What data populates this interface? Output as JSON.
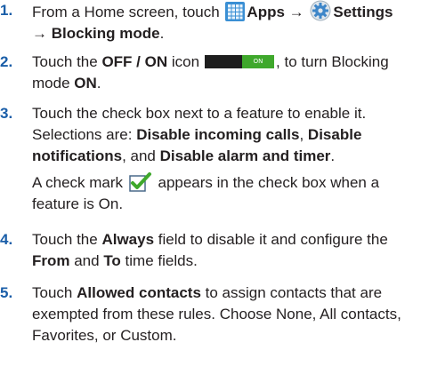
{
  "steps": [
    {
      "number": "1.",
      "t1": "From a Home screen, touch ",
      "apps_label": "Apps",
      "arrow1": " → ",
      "settings_label": "Settings",
      "line2_arrow": "→ ",
      "blocking_label": "Blocking mode",
      "end": "."
    },
    {
      "number": "2.",
      "t1": "Touch the ",
      "offon_label": "OFF / ON",
      "t2": " icon",
      "toggle_text": "ON",
      "t3": ", to turn Blocking",
      "t4": "mode ",
      "on_label": "ON",
      "end": "."
    },
    {
      "number": "3.",
      "line1": "Touch the check box next to a feature to enable it.",
      "t2": "Selections are: ",
      "opt1": "Disable incoming calls",
      "comma1": ", ",
      "opt2a": "Disable",
      "opt2b": "notifications",
      "t3": ", and ",
      "opt3": "Disable alarm and timer",
      "end": ".",
      "note1": "A check mark ",
      "note2": " appears in the check box when a",
      "note3": "feature is On."
    },
    {
      "number": "4.",
      "t1": "Touch the ",
      "always_label": "Always",
      "t2": " field to disable it and configure the",
      "from_label": "From",
      "t3": " and ",
      "to_label": "To",
      "t4": " time fields."
    },
    {
      "number": "5.",
      "t1": "Touch ",
      "allowed_label": "Allowed contacts",
      "t2": " to assign contacts that are",
      "line2": "exempted from these rules. Choose None, All contacts,",
      "line3": "Favorites, or Custom."
    }
  ],
  "icons": {
    "apps": "apps-grid-icon",
    "settings": "settings-gear-icon",
    "toggle": "on-off-toggle-icon",
    "check": "check-mark-icon"
  },
  "colors": {
    "number_blue": "#1a5ea8",
    "toggle_green": "#3fa82c",
    "toggle_dark": "#1e1e1e",
    "check_green": "#3fa82c"
  }
}
